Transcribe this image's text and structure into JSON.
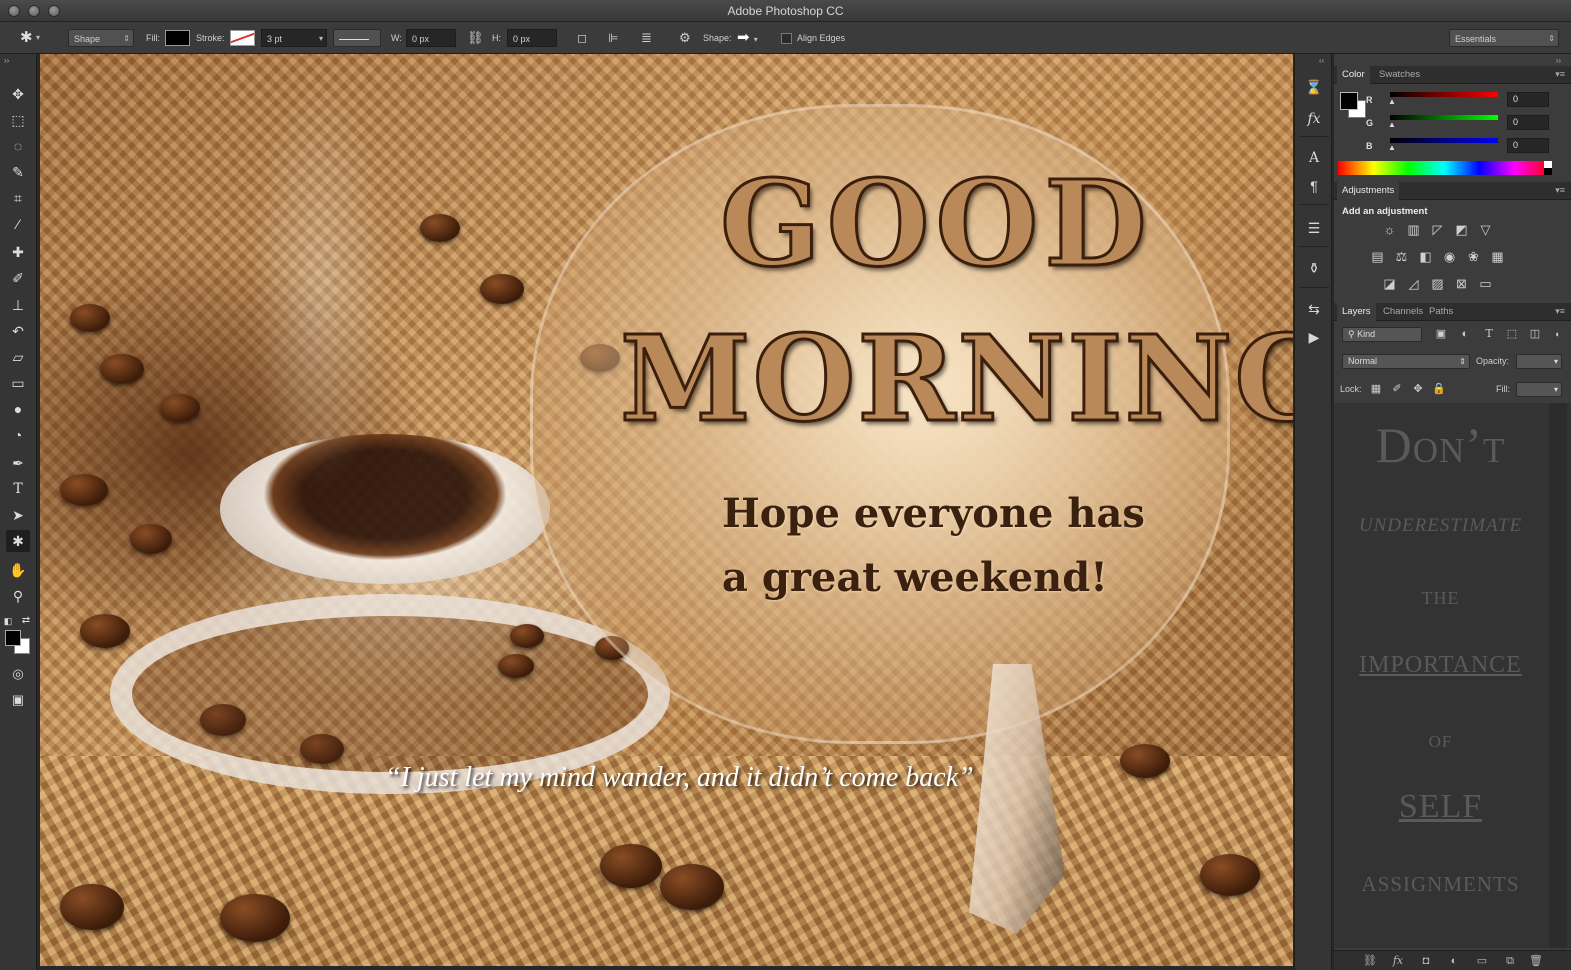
{
  "window": {
    "title": "Adobe Photoshop CC"
  },
  "options_bar": {
    "tool_mode": "Shape",
    "fill_label": "Fill:",
    "stroke_label": "Stroke:",
    "stroke_width": "3 pt",
    "w_label": "W:",
    "w_value": "0 px",
    "h_label": "H:",
    "h_value": "0 px",
    "shape_label": "Shape:",
    "align_edges_label": "Align Edges",
    "workspace": "Essentials",
    "fill_color": "#000000"
  },
  "tools": [
    "move-tool-icon",
    "marquee-tool-icon",
    "lasso-tool-icon",
    "quick-selection-tool-icon",
    "crop-tool-icon",
    "eyedropper-tool-icon",
    "healing-brush-tool-icon",
    "brush-tool-icon",
    "clone-stamp-tool-icon",
    "history-brush-tool-icon",
    "eraser-tool-icon",
    "gradient-tool-icon",
    "blur-tool-icon",
    "dodge-tool-icon",
    "pen-tool-icon",
    "type-tool-icon",
    "path-selection-tool-icon",
    "custom-shape-tool-icon",
    "hand-tool-icon",
    "zoom-tool-icon"
  ],
  "canvas": {
    "headline_1": "GOOD",
    "headline_2": "MORNING!",
    "subline_1": "Hope everyone has",
    "subline_2": "a great weekend!",
    "quote": "“I just let my mind wander, and it didn’t come back”"
  },
  "color_panel": {
    "tabs": [
      "Color",
      "Swatches"
    ],
    "r_label": "R",
    "r_value": "0",
    "g_label": "G",
    "g_value": "0",
    "b_label": "B",
    "b_value": "0"
  },
  "adjustments_panel": {
    "tab": "Adjustments",
    "title": "Add an adjustment"
  },
  "layers_panel": {
    "tabs": [
      "Layers",
      "Channels",
      "Paths"
    ],
    "filter_kind": "Kind",
    "blend_mode": "Normal",
    "opacity_label": "Opacity:",
    "lock_label": "Lock:",
    "fill_label": "Fill:",
    "preview_text": {
      "line1": "Don’t",
      "line2": "UNDERESTIMATE",
      "line3": "THE",
      "line4": "IMPORTANCE",
      "line5": "OF",
      "line6": "SELF",
      "line7": "ASSIGNMENTS"
    }
  }
}
